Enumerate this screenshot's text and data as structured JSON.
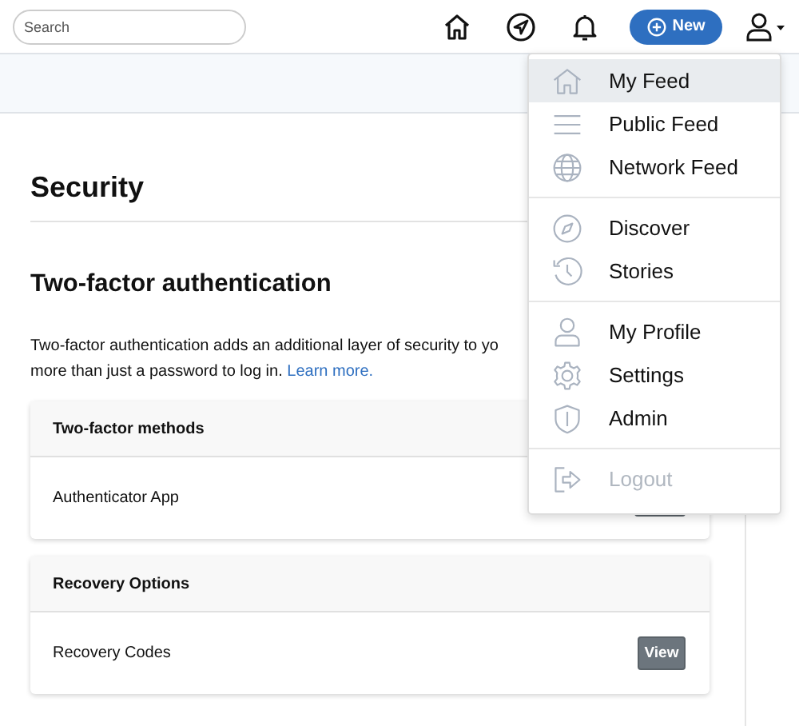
{
  "header": {
    "search": {
      "placeholder": "Search"
    },
    "new_button": "New"
  },
  "page": {
    "title": "Security",
    "section_title": "Two-factor authentication",
    "description_lines": [
      "Two-factor authentication adds an additional layer of security to yo",
      "more than just a password to log in."
    ],
    "learn_more": "Learn more.",
    "cards": [
      {
        "title": "Two-factor methods",
        "rows": [
          {
            "label": "Authenticator App"
          }
        ]
      },
      {
        "title": "Recovery Options",
        "rows": [
          {
            "label": "Recovery Codes",
            "button": "View"
          }
        ]
      }
    ]
  },
  "user_menu": {
    "groups": [
      [
        {
          "label": "My Feed",
          "kind": "home",
          "selected": true,
          "disabled": false
        },
        {
          "label": "Public Feed",
          "kind": "lines",
          "selected": false,
          "disabled": false
        },
        {
          "label": "Network Feed",
          "kind": "globe",
          "selected": false,
          "disabled": false
        }
      ],
      [
        {
          "label": "Discover",
          "kind": "compass",
          "selected": false,
          "disabled": false
        },
        {
          "label": "Stories",
          "kind": "history",
          "selected": false,
          "disabled": false
        }
      ],
      [
        {
          "label": "My Profile",
          "kind": "user",
          "selected": false,
          "disabled": false
        },
        {
          "label": "Settings",
          "kind": "gear",
          "selected": false,
          "disabled": false
        },
        {
          "label": "Admin",
          "kind": "shield",
          "selected": false,
          "disabled": false
        }
      ],
      [
        {
          "label": "Logout",
          "kind": "logout",
          "selected": false,
          "disabled": true
        }
      ]
    ]
  }
}
